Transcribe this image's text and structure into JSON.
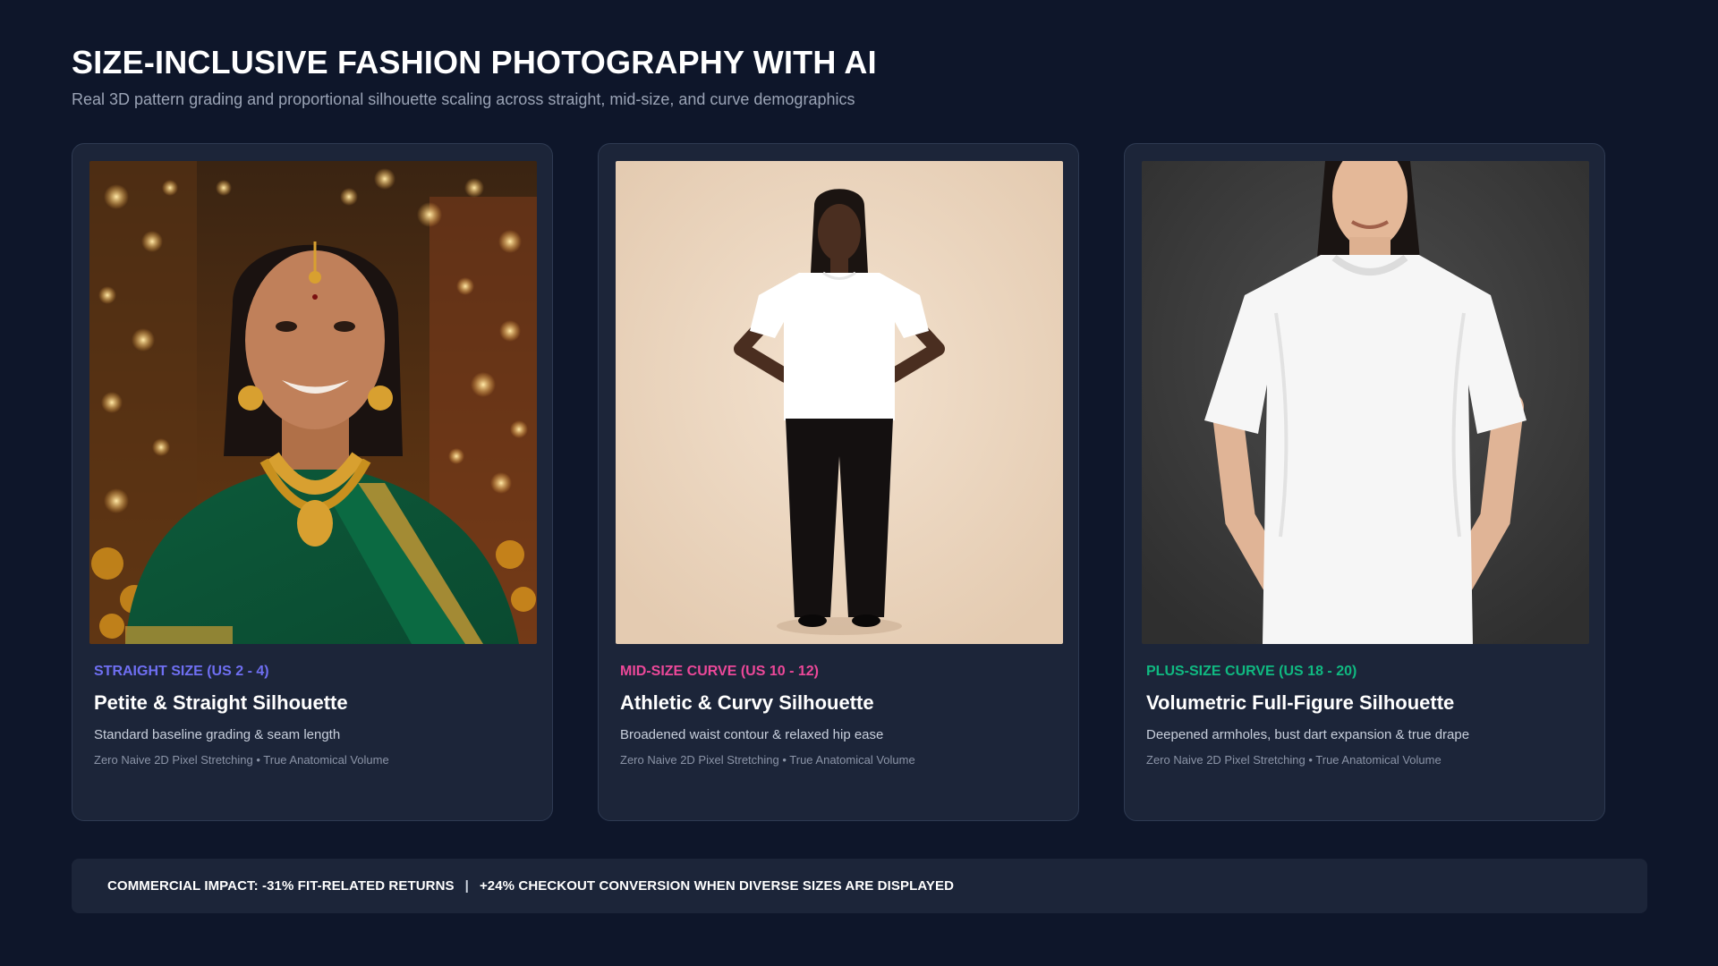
{
  "header": {
    "title": "SIZE-INCLUSIVE FASHION PHOTOGRAPHY WITH AI",
    "subtitle": "Real 3D pattern grading and proportional silhouette scaling across straight, mid-size, and curve demographics"
  },
  "cards": [
    {
      "tier": "STRAIGHT SIZE (US 2 - 4)",
      "tier_color": "#6f6ff2",
      "title": "Petite & Straight Silhouette",
      "description": "Standard baseline grading & seam length",
      "note": "Zero Naive 2D Pixel Stretching • True Anatomical Volume"
    },
    {
      "tier": "MID-SIZE CURVE (US 10 - 12)",
      "tier_color": "#ec4899",
      "title": "Athletic & Curvy Silhouette",
      "description": "Broadened waist contour & relaxed hip ease",
      "note": "Zero Naive 2D Pixel Stretching • True Anatomical Volume"
    },
    {
      "tier": "PLUS-SIZE CURVE (US 18 - 20)",
      "tier_color": "#10b981",
      "title": "Volumetric Full-Figure Silhouette",
      "description": "Deepened armholes, bust dart expansion & true drape",
      "note": "Zero Naive 2D Pixel Stretching • True Anatomical Volume"
    }
  ],
  "footer": {
    "left": "COMMERCIAL IMPACT: -31% FIT-RELATED RETURNS",
    "separator": "|",
    "right": "+24% CHECKOUT CONVERSION WHEN DIVERSE SIZES ARE DISPLAYED"
  }
}
